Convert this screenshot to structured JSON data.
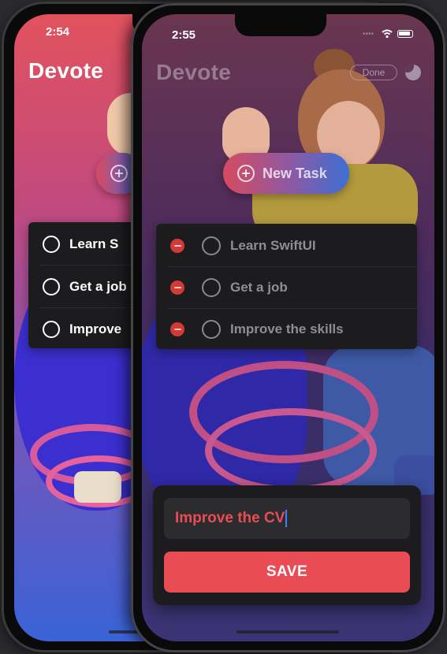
{
  "back_screen": {
    "time": "2:54",
    "app_title": "Devote",
    "tasks": [
      {
        "label": "Learn S"
      },
      {
        "label": "Get a job"
      },
      {
        "label": "Improve"
      }
    ]
  },
  "front_screen": {
    "time": "2:55",
    "app_title": "Devote",
    "done_label": "Done",
    "new_task_label": "New Task",
    "tasks": [
      {
        "label": "Learn SwiftUI"
      },
      {
        "label": "Get a job"
      },
      {
        "label": "Improve the skills"
      }
    ],
    "editor": {
      "input_value": "Improve the CV",
      "save_label": "SAVE"
    }
  },
  "colors": {
    "accent_red": "#ea4c56",
    "delete_red": "#d23a35",
    "panel_dark": "#1c1c1e"
  }
}
